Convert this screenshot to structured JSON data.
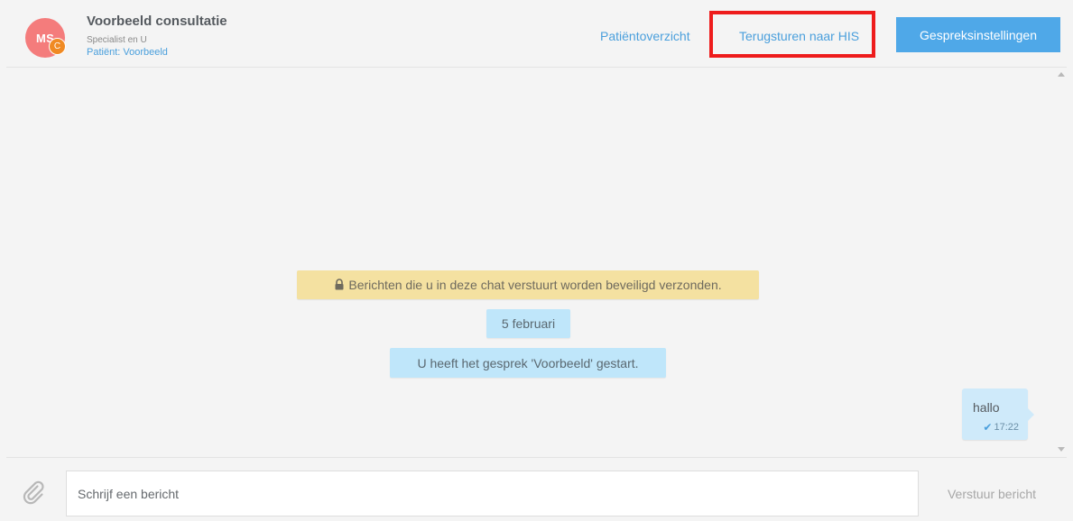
{
  "header": {
    "avatar_initials": "MS",
    "avatar_badge": "C",
    "title": "Voorbeeld consultatie",
    "subtitle": "Specialist en U",
    "patient_label": "Patiënt: Voorbeeld",
    "nav": {
      "overview": "Patiëntoverzicht",
      "send_back": "Terugsturen naar HIS"
    },
    "settings_button": "Gespreksinstellingen"
  },
  "chat": {
    "security_notice": "Berichten die u in deze chat verstuurt worden beveiligd verzonden.",
    "date_divider": "5 februari",
    "system_message": "U heeft het gesprek 'Voorbeeld' gestart.",
    "messages": [
      {
        "text": "hallo",
        "time": "17:22",
        "status": "sent"
      }
    ]
  },
  "composer": {
    "placeholder": "Schrijf een bericht",
    "send_label": "Verstuur bericht"
  },
  "colors": {
    "accent": "#4fa8e8",
    "link": "#4a9fdc",
    "avatar": "#f47c7c",
    "badge": "#f08a24",
    "notice_bg": "#f4e1a1",
    "chip_bg": "#bfe6fa",
    "highlight": "#ee1c1c"
  },
  "icons": {
    "lock": "lock-icon",
    "check": "check-icon",
    "attach": "paperclip-icon"
  }
}
